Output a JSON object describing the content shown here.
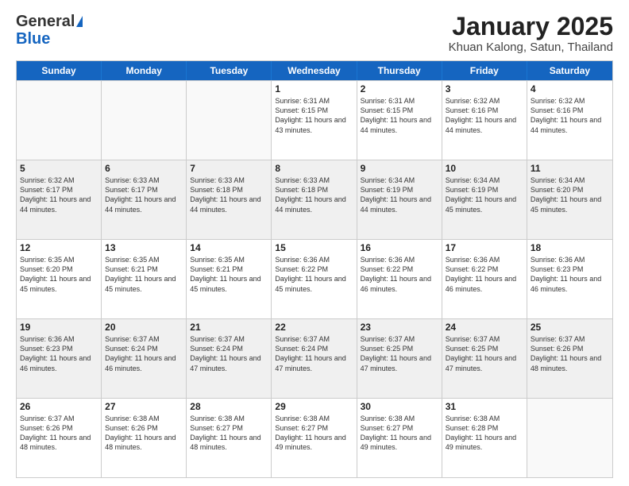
{
  "logo": {
    "general": "General",
    "blue": "Blue"
  },
  "title": "January 2025",
  "subtitle": "Khuan Kalong, Satun, Thailand",
  "days_of_week": [
    "Sunday",
    "Monday",
    "Tuesday",
    "Wednesday",
    "Thursday",
    "Friday",
    "Saturday"
  ],
  "weeks": [
    [
      {
        "num": "",
        "info": "",
        "empty": true
      },
      {
        "num": "",
        "info": "",
        "empty": true
      },
      {
        "num": "",
        "info": "",
        "empty": true
      },
      {
        "num": "1",
        "info": "Sunrise: 6:31 AM\nSunset: 6:15 PM\nDaylight: 11 hours and 43 minutes.",
        "empty": false
      },
      {
        "num": "2",
        "info": "Sunrise: 6:31 AM\nSunset: 6:15 PM\nDaylight: 11 hours and 44 minutes.",
        "empty": false
      },
      {
        "num": "3",
        "info": "Sunrise: 6:32 AM\nSunset: 6:16 PM\nDaylight: 11 hours and 44 minutes.",
        "empty": false
      },
      {
        "num": "4",
        "info": "Sunrise: 6:32 AM\nSunset: 6:16 PM\nDaylight: 11 hours and 44 minutes.",
        "empty": false
      }
    ],
    [
      {
        "num": "5",
        "info": "Sunrise: 6:32 AM\nSunset: 6:17 PM\nDaylight: 11 hours and 44 minutes.",
        "empty": false
      },
      {
        "num": "6",
        "info": "Sunrise: 6:33 AM\nSunset: 6:17 PM\nDaylight: 11 hours and 44 minutes.",
        "empty": false
      },
      {
        "num": "7",
        "info": "Sunrise: 6:33 AM\nSunset: 6:18 PM\nDaylight: 11 hours and 44 minutes.",
        "empty": false
      },
      {
        "num": "8",
        "info": "Sunrise: 6:33 AM\nSunset: 6:18 PM\nDaylight: 11 hours and 44 minutes.",
        "empty": false
      },
      {
        "num": "9",
        "info": "Sunrise: 6:34 AM\nSunset: 6:19 PM\nDaylight: 11 hours and 44 minutes.",
        "empty": false
      },
      {
        "num": "10",
        "info": "Sunrise: 6:34 AM\nSunset: 6:19 PM\nDaylight: 11 hours and 45 minutes.",
        "empty": false
      },
      {
        "num": "11",
        "info": "Sunrise: 6:34 AM\nSunset: 6:20 PM\nDaylight: 11 hours and 45 minutes.",
        "empty": false
      }
    ],
    [
      {
        "num": "12",
        "info": "Sunrise: 6:35 AM\nSunset: 6:20 PM\nDaylight: 11 hours and 45 minutes.",
        "empty": false
      },
      {
        "num": "13",
        "info": "Sunrise: 6:35 AM\nSunset: 6:21 PM\nDaylight: 11 hours and 45 minutes.",
        "empty": false
      },
      {
        "num": "14",
        "info": "Sunrise: 6:35 AM\nSunset: 6:21 PM\nDaylight: 11 hours and 45 minutes.",
        "empty": false
      },
      {
        "num": "15",
        "info": "Sunrise: 6:36 AM\nSunset: 6:22 PM\nDaylight: 11 hours and 45 minutes.",
        "empty": false
      },
      {
        "num": "16",
        "info": "Sunrise: 6:36 AM\nSunset: 6:22 PM\nDaylight: 11 hours and 46 minutes.",
        "empty": false
      },
      {
        "num": "17",
        "info": "Sunrise: 6:36 AM\nSunset: 6:22 PM\nDaylight: 11 hours and 46 minutes.",
        "empty": false
      },
      {
        "num": "18",
        "info": "Sunrise: 6:36 AM\nSunset: 6:23 PM\nDaylight: 11 hours and 46 minutes.",
        "empty": false
      }
    ],
    [
      {
        "num": "19",
        "info": "Sunrise: 6:36 AM\nSunset: 6:23 PM\nDaylight: 11 hours and 46 minutes.",
        "empty": false
      },
      {
        "num": "20",
        "info": "Sunrise: 6:37 AM\nSunset: 6:24 PM\nDaylight: 11 hours and 46 minutes.",
        "empty": false
      },
      {
        "num": "21",
        "info": "Sunrise: 6:37 AM\nSunset: 6:24 PM\nDaylight: 11 hours and 47 minutes.",
        "empty": false
      },
      {
        "num": "22",
        "info": "Sunrise: 6:37 AM\nSunset: 6:24 PM\nDaylight: 11 hours and 47 minutes.",
        "empty": false
      },
      {
        "num": "23",
        "info": "Sunrise: 6:37 AM\nSunset: 6:25 PM\nDaylight: 11 hours and 47 minutes.",
        "empty": false
      },
      {
        "num": "24",
        "info": "Sunrise: 6:37 AM\nSunset: 6:25 PM\nDaylight: 11 hours and 47 minutes.",
        "empty": false
      },
      {
        "num": "25",
        "info": "Sunrise: 6:37 AM\nSunset: 6:26 PM\nDaylight: 11 hours and 48 minutes.",
        "empty": false
      }
    ],
    [
      {
        "num": "26",
        "info": "Sunrise: 6:37 AM\nSunset: 6:26 PM\nDaylight: 11 hours and 48 minutes.",
        "empty": false
      },
      {
        "num": "27",
        "info": "Sunrise: 6:38 AM\nSunset: 6:26 PM\nDaylight: 11 hours and 48 minutes.",
        "empty": false
      },
      {
        "num": "28",
        "info": "Sunrise: 6:38 AM\nSunset: 6:27 PM\nDaylight: 11 hours and 48 minutes.",
        "empty": false
      },
      {
        "num": "29",
        "info": "Sunrise: 6:38 AM\nSunset: 6:27 PM\nDaylight: 11 hours and 49 minutes.",
        "empty": false
      },
      {
        "num": "30",
        "info": "Sunrise: 6:38 AM\nSunset: 6:27 PM\nDaylight: 11 hours and 49 minutes.",
        "empty": false
      },
      {
        "num": "31",
        "info": "Sunrise: 6:38 AM\nSunset: 6:28 PM\nDaylight: 11 hours and 49 minutes.",
        "empty": false
      },
      {
        "num": "",
        "info": "",
        "empty": true
      }
    ]
  ]
}
